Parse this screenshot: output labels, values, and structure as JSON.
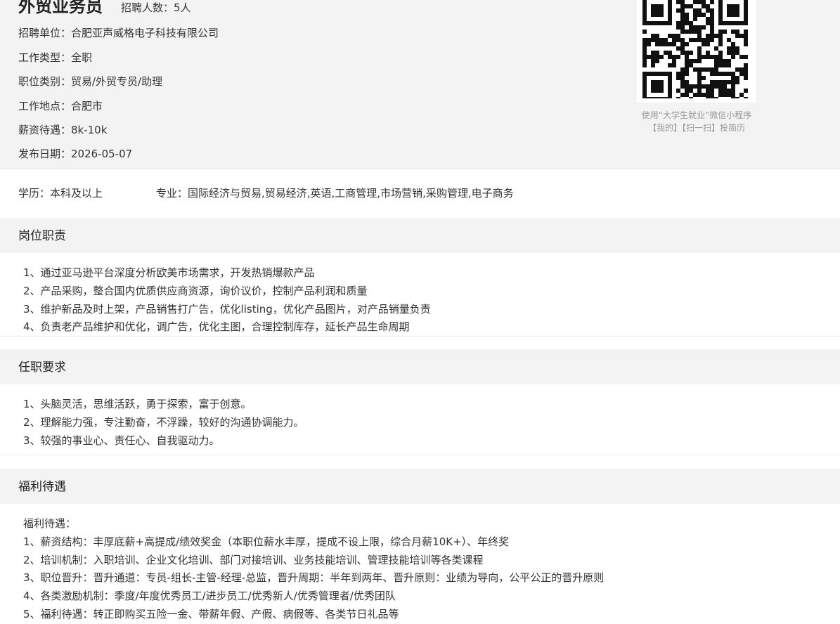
{
  "job": {
    "title": "外贸业务员",
    "hire_count": "招聘人数：5人",
    "employer": "招聘单位：合肥亚声威格电子科技有限公司",
    "work_type": "工作类型：全职",
    "category": "职位类别：贸易/外贸专员/助理",
    "location": "工作地点：合肥市",
    "salary": "薪资待遇：8k-10k",
    "post_date": "发布日期：2026-05-07"
  },
  "qr": {
    "icon": "qr-code-icon",
    "caption_line1": "使用“大学生就业”微信小程序",
    "caption_line2": "【我的】【扫一扫】投简历"
  },
  "requirements": {
    "education": "学历：本科及以上",
    "major": "专业：国际经济与贸易,贸易经济,英语,工商管理,市场营销,采购管理,电子商务"
  },
  "sections": {
    "duties": {
      "title": "岗位职责",
      "items": [
        "1、通过亚马逊平台深度分析欧美市场需求，开发热销爆款产品",
        "2、产品采购，整合国内优质供应商资源，询价议价，控制产品利润和质量",
        "3、维护新品及时上架，产品销售打广告，优化listing，优化产品图片，对产品销量负责",
        "4、负责老产品维护和优化，调广告，优化主图，合理控制库存，延长产品生命周期"
      ]
    },
    "qualifications": {
      "title": "任职要求",
      "items": [
        "1、头脑灵活，思维活跃，勇于探索，富于创意。",
        "2、理解能力强，专注勤奋，不浮躁，较好的沟通协调能力。",
        "3、较强的事业心、责任心、自我驱动力。"
      ]
    },
    "benefits": {
      "title": "福利待遇",
      "items": [
        "福利待遇：",
        "1、薪资结构：丰厚底薪+高提成/绩效奖金（本职位薪水丰厚，提成不设上限，综合月薪10K+）、年终奖",
        "2、培训机制：入职培训、企业文化培训、部门对接培训、业务技能培训、管理技能培训等各类课程",
        "3、职位晋升：晋升通道：专员-组长-主管-经理-总监，晋升周期：半年到两年、晋升原则：业绩为导向，公平公正的晋升原则",
        "4、各类激励机制：季度/年度优秀员工/进步员工/优秀新人/优秀管理者/优秀团队",
        "5、福利待遇：转正即购买五险一金、带薪年假、产假、病假等、各类节日礼品等"
      ]
    }
  }
}
